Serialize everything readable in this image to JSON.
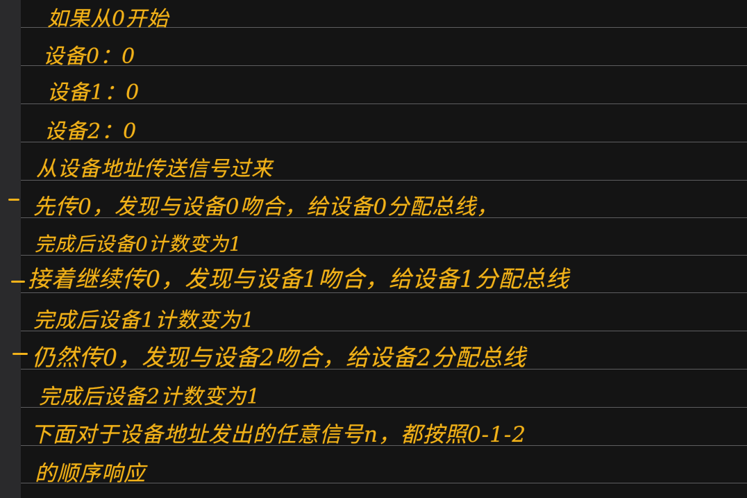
{
  "note": {
    "lines": [
      "如果从0开始",
      "设备0：0",
      "设备1：0",
      "设备2：0",
      "从设备地址传送信号过来",
      "先传0，发现与设备0吻合，给设备0分配总线，",
      "完成后设备0计数变为1",
      "接着继续传0，发现与设备1吻合，给设备1分配总线",
      "完成后设备1计数变为1",
      "仍然传0，发现与设备2吻合，给设备2分配总线",
      "完成后设备2计数变为1",
      "下面对于设备地址发出的任意信号n，都按照0-1-2",
      "的顺序响应"
    ]
  },
  "colors": {
    "ink": "#f2b21a",
    "background": "#141414",
    "rule": "#5e5e60",
    "margin_strip": "#2a2a2c"
  }
}
